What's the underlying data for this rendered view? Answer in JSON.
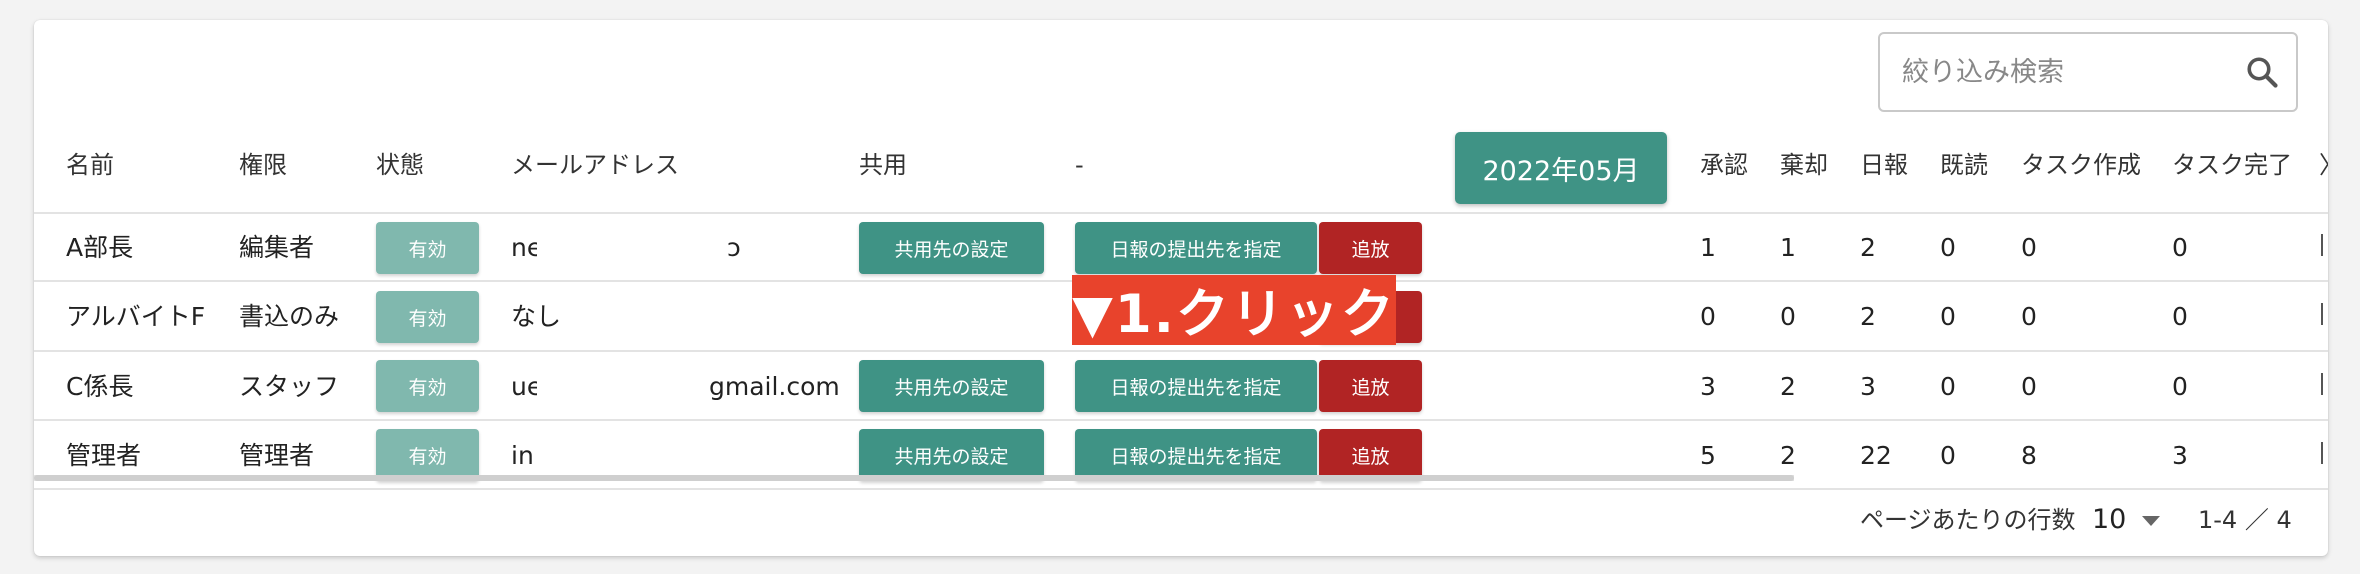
{
  "search": {
    "placeholder": "絞り込み検索"
  },
  "month_button": "2022年05月",
  "columns": {
    "name": "名前",
    "role": "権限",
    "status": "状態",
    "email": "メールアドレス",
    "shared": "共用",
    "dash": "-",
    "approve": "承認",
    "reject": "棄却",
    "report": "日報",
    "read": "既読",
    "task_created": "タスク作成",
    "task_done": "タスク完了",
    "more": "〉"
  },
  "rows": [
    {
      "name": "A部長",
      "role": "編集者",
      "status": "有効",
      "email_prefix": "ne",
      "email_suffix": "ɔ",
      "share": "共用先の設定",
      "submit": "日報の提出先を指定",
      "expel": "追放",
      "approve": "1",
      "reject": "1",
      "report": "2",
      "read": "0",
      "task_created": "0",
      "task_done": "0"
    },
    {
      "name": "アルバイトF",
      "role": "書込のみ",
      "status": "有効",
      "email_prefix": "なし",
      "email_suffix": "",
      "share": "",
      "submit": "",
      "expel": "",
      "approve": "0",
      "reject": "0",
      "report": "2",
      "read": "0",
      "task_created": "0",
      "task_done": "0"
    },
    {
      "name": "C係長",
      "role": "スタッフ",
      "status": "有効",
      "email_prefix": "ue",
      "email_suffix": "gmail.com",
      "share": "共用先の設定",
      "submit": "日報の提出先を指定",
      "expel": "追放",
      "approve": "3",
      "reject": "2",
      "report": "3",
      "read": "0",
      "task_created": "0",
      "task_done": "0"
    },
    {
      "name": "管理者",
      "role": "管理者",
      "status": "有効",
      "email_prefix": "in",
      "email_suffix": "",
      "share": "共用先の設定",
      "submit": "日報の提出先を指定",
      "expel": "追放",
      "approve": "5",
      "reject": "2",
      "report": "22",
      "read": "0",
      "task_created": "8",
      "task_done": "3"
    }
  ],
  "annotation": "▼1.クリック",
  "footer": {
    "rows_per_page_label": "ページあたりの行数",
    "rows_per_page": "10",
    "range": "1-4 ／ 4"
  },
  "colors": {
    "teal": "#3f9385",
    "status": "#80b8ae",
    "expel": "#b12424",
    "annotation": "#e8432c"
  },
  "icons": {
    "search": "search-icon",
    "dropdown": "triangle-down-icon"
  }
}
